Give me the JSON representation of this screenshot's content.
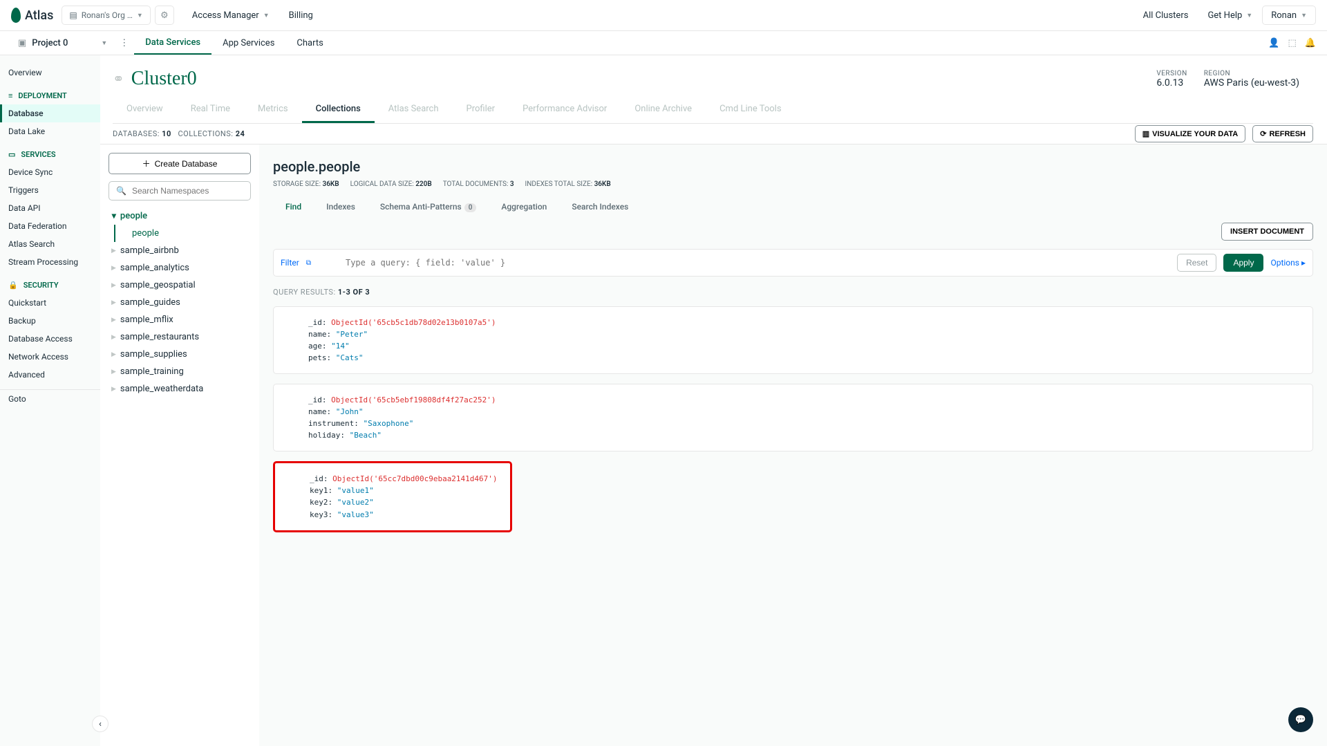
{
  "topbar": {
    "logo": "Atlas",
    "org": "Ronan's Org …",
    "access_manager": "Access Manager",
    "billing": "Billing",
    "all_clusters": "All Clusters",
    "get_help": "Get Help",
    "user": "Ronan"
  },
  "navbar": {
    "project": "Project 0",
    "tabs": [
      "Data Services",
      "App Services",
      "Charts"
    ]
  },
  "sidebar": {
    "overview": "Overview",
    "deployment": "DEPLOYMENT",
    "deployment_items": [
      "Database",
      "Data Lake"
    ],
    "services": "SERVICES",
    "services_items": [
      "Device Sync",
      "Triggers",
      "Data API",
      "Data Federation",
      "Atlas Search",
      "Stream Processing"
    ],
    "security": "SECURITY",
    "security_items": [
      "Quickstart",
      "Backup",
      "Database Access",
      "Network Access",
      "Advanced"
    ],
    "goto": "Goto"
  },
  "cluster": {
    "name": "Cluster0",
    "version_label": "VERSION",
    "version": "6.0.13",
    "region_label": "REGION",
    "region": "AWS Paris (eu-west-3)",
    "tabs": [
      "Overview",
      "Real Time",
      "Metrics",
      "Collections",
      "Atlas Search",
      "Profiler",
      "Performance Advisor",
      "Online Archive",
      "Cmd Line Tools"
    ]
  },
  "stats": {
    "databases_label": "DATABASES:",
    "databases": "10",
    "collections_label": "COLLECTIONS:",
    "collections": "24",
    "visualize": "VISUALIZE YOUR DATA",
    "refresh": "REFRESH"
  },
  "dbpanel": {
    "create": "Create Database",
    "search_placeholder": "Search Namespaces",
    "databases": [
      "people",
      "sample_airbnb",
      "sample_analytics",
      "sample_geospatial",
      "sample_guides",
      "sample_mflix",
      "sample_restaurants",
      "sample_supplies",
      "sample_training",
      "sample_weatherdata"
    ],
    "expanded_collection": "people"
  },
  "collection": {
    "title": "people.people",
    "storage_label": "STORAGE SIZE:",
    "storage": "36KB",
    "logical_label": "LOGICAL DATA SIZE:",
    "logical": "220B",
    "total_docs_label": "TOTAL DOCUMENTS:",
    "total_docs": "3",
    "indexes_label": "INDEXES TOTAL SIZE:",
    "indexes": "36KB",
    "tabs": [
      "Find",
      "Indexes",
      "Schema Anti-Patterns",
      "Aggregation",
      "Search Indexes"
    ],
    "schema_badge": "0",
    "insert": "INSERT DOCUMENT",
    "filter_label": "Filter",
    "filter_placeholder": "Type a query: { field: 'value' }",
    "reset": "Reset",
    "apply": "Apply",
    "options": "Options",
    "results_label": "QUERY RESULTS:",
    "results_range": "1-3 OF 3"
  },
  "documents": [
    {
      "fields": [
        {
          "k": "_id",
          "type": "objid",
          "v": "ObjectId('65cb5c1db78d02e13b0107a5')"
        },
        {
          "k": "name",
          "type": "str",
          "v": "\"Peter\""
        },
        {
          "k": "age",
          "type": "str",
          "v": "\"14\""
        },
        {
          "k": "pets",
          "type": "str",
          "v": "\"Cats\""
        }
      ],
      "hl": false
    },
    {
      "fields": [
        {
          "k": "_id",
          "type": "objid",
          "v": "ObjectId('65cb5ebf19808df4f27ac252')"
        },
        {
          "k": "name",
          "type": "str",
          "v": "\"John\""
        },
        {
          "k": "instrument",
          "type": "str",
          "v": "\"Saxophone\""
        },
        {
          "k": "holiday",
          "type": "str",
          "v": "\"Beach\""
        }
      ],
      "hl": false
    },
    {
      "fields": [
        {
          "k": "_id",
          "type": "objid",
          "v": "ObjectId('65cc7dbd00c9ebaa2141d467')"
        },
        {
          "k": "key1",
          "type": "str",
          "v": "\"value1\""
        },
        {
          "k": "key2",
          "type": "str",
          "v": "\"value2\""
        },
        {
          "k": "key3",
          "type": "str",
          "v": "\"value3\""
        }
      ],
      "hl": true
    }
  ]
}
